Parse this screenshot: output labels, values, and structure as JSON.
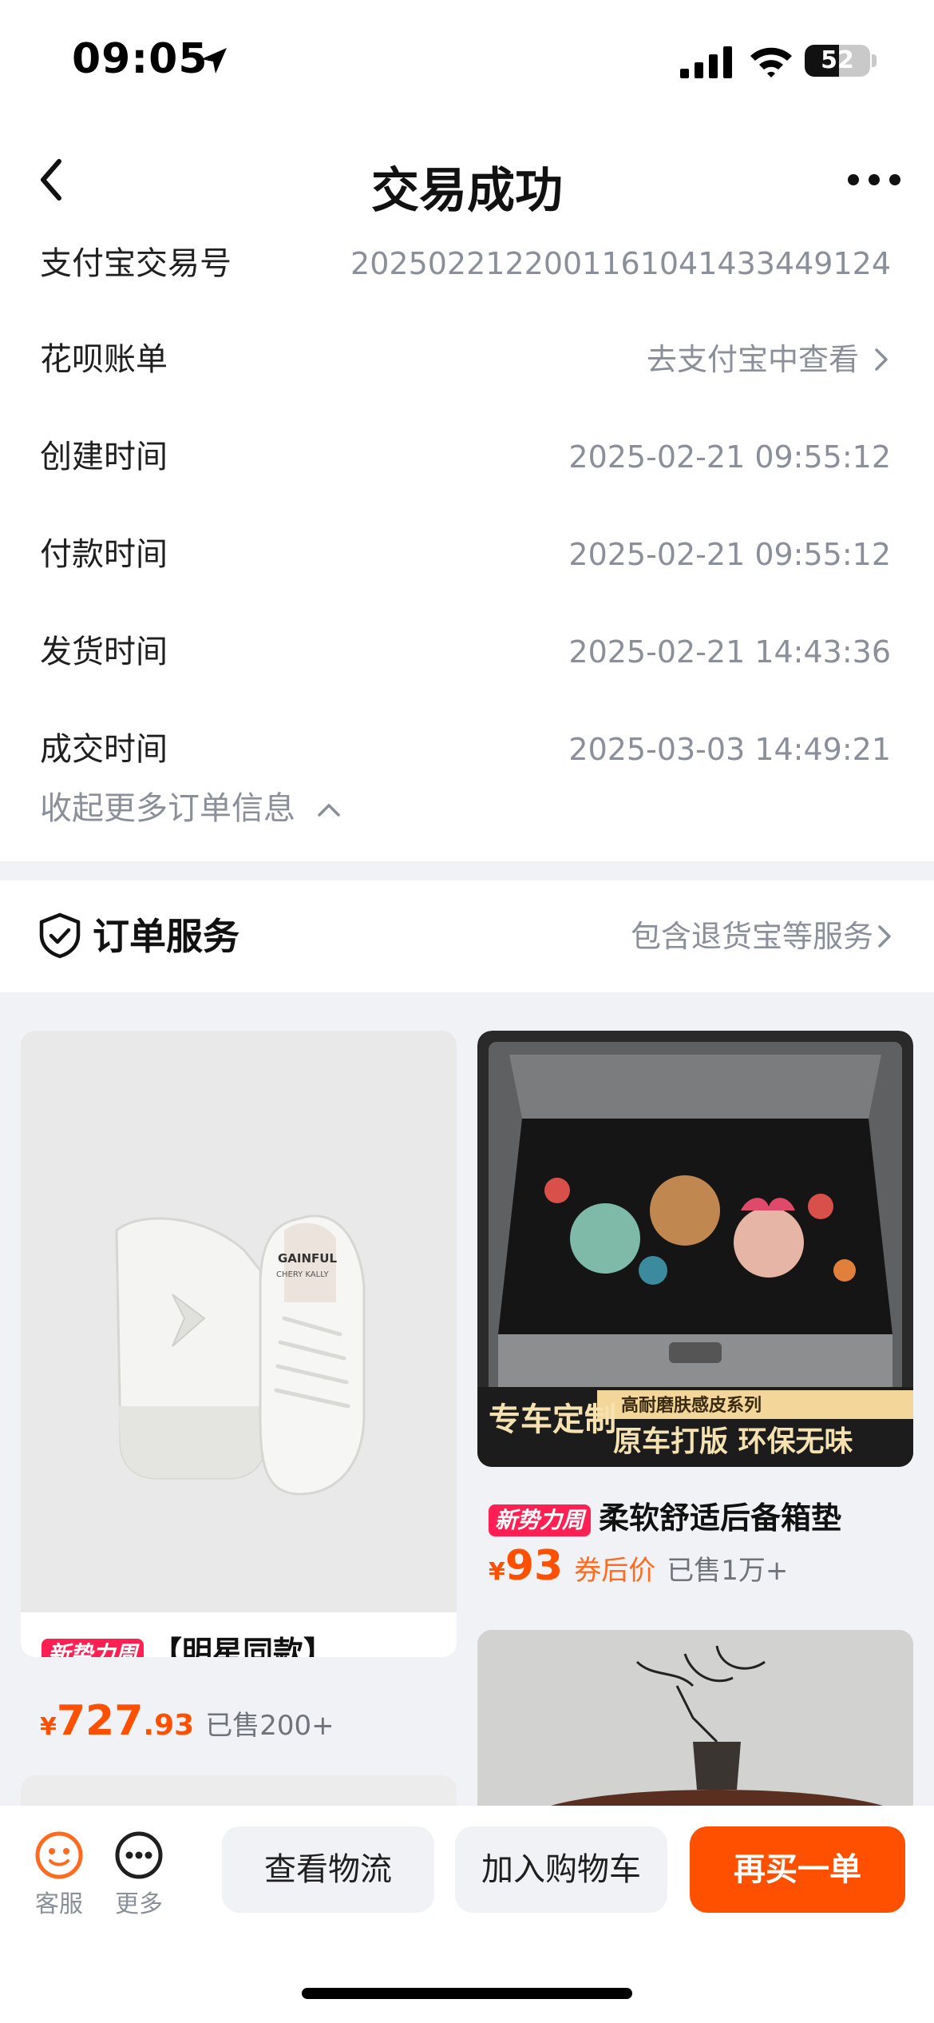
{
  "status_bar": {
    "time": "09:05",
    "battery": "52",
    "battery_level": 0.52
  },
  "nav": {
    "title": "交易成功"
  },
  "order_info": [
    {
      "label": "支付宝交易号",
      "value": "2025022122001161041433449124"
    },
    {
      "label": "花呗账单",
      "value": "去支付宝中查看"
    },
    {
      "label": "创建时间",
      "value": "2025-02-21 09:55:12"
    },
    {
      "label": "付款时间",
      "value": "2025-02-21 09:55:12"
    },
    {
      "label": "发货时间",
      "value": "2025-02-21 14:43:36"
    },
    {
      "label": "成交时间",
      "value": "2025-03-03 14:49:21"
    }
  ],
  "collapse_label": "收起更多订单信息",
  "service": {
    "title": "订单服务",
    "desc": "包含退货宝等服务"
  },
  "products": [
    {
      "tag": "新势力周",
      "title": "【明星同款】",
      "price_symbol": "¥",
      "price_int": "727",
      "price_dec": ".93",
      "coupon_label": "",
      "sold": "已售200+",
      "shoe_brand": "GAINFUL",
      "shoe_sub": "CHERY KALLY"
    },
    {
      "tag": "新势力周",
      "title": "柔软舒适后备箱垫",
      "price_symbol": "¥",
      "price_int": "93",
      "price_dec": "",
      "coupon_label": "券后价",
      "sold": "已售1万+",
      "banner_left": "专车定制",
      "banner_top": "高耐磨肤感皮系列",
      "banner_main": "原车打版 环保无味"
    }
  ],
  "bottom_bar": {
    "service_label": "客服",
    "more_label": "更多",
    "logistics": "查看物流",
    "add_cart": "加入购物车",
    "buy_again": "再买一单"
  },
  "colors": {
    "accent": "#ff5000",
    "tag": "#ff1f52",
    "muted": "#8a8f99",
    "feed_bg": "#f1f2f5"
  }
}
